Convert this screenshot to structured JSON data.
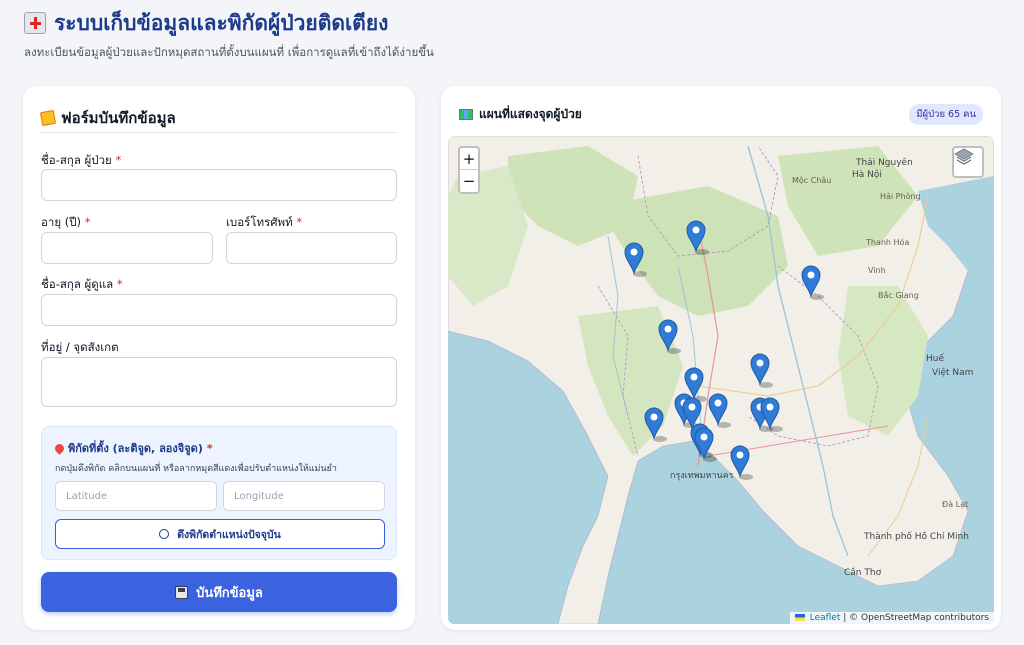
{
  "header": {
    "title": "ระบบเก็บข้อมูลและพิกัดผู้ป่วยติดเตียง",
    "subtitle": "ลงทะเบียนข้อมูลผู้ป่วยและปักหมุดสถานที่ตั้งบนแผนที่ เพื่อการดูแลที่เข้าถึงได้ง่ายขึ้น"
  },
  "form": {
    "title": "ฟอร์มบันทึกข้อมูล",
    "patient_name_label": "ชื่อ-สกุล ผู้ป่วย",
    "age_label": "อายุ (ปี)",
    "phone_label": "เบอร์โทรศัพท์",
    "caregiver_label": "ชื่อ-สกุล ผู้ดูแล",
    "address_label": "ที่อยู่ / จุดสังเกต",
    "required_mark": "*",
    "patient_name_value": "",
    "age_value": "",
    "phone_value": "",
    "caregiver_value": "",
    "address_value": "",
    "geo": {
      "title": "พิกัดที่ตั้ง (ละติจูด, ลองจิจูด)",
      "hint": "กดปุ่มดึงพิกัด คลิกบนแผนที่ หรือลากหมุดสีแดงเพื่อปรับตำแหน่งให้แม่นยำ",
      "lat_placeholder": "Latitude",
      "lng_placeholder": "Longitude",
      "gps_button": "ดึงพิกัดตำแหน่งปัจจุบัน"
    },
    "save_button": "บันทึกข้อมูล"
  },
  "map": {
    "title": "แผนที่แสดงจุดผู้ป่วย",
    "count_badge": "มีผู้ป่วย 65 คน",
    "zoom_in": "+",
    "zoom_out": "−",
    "attribution_leaflet": "Leaflet",
    "attribution_osm": "| © OpenStreetMap contributors",
    "labels": {
      "hanoi": "Hà Nội",
      "haiphong": "Hải Phòng",
      "vietnam": "Việt Nam",
      "hue": "Huế",
      "hcm": "Thành phố Hồ Chí Minh",
      "cantho": "Cần Thơ",
      "thainguyen": "Thái Nguyên",
      "dalat": "Đà Lạt",
      "vinh": "Vinh",
      "bangkok": "กรุงเทพมหานคร",
      "thanhhoa": "Thanh Hóa",
      "mocchau": "Mộc Châu",
      "baygiang": "Bắc Giang"
    },
    "marker_color": "#2f7bd6"
  },
  "colors": {
    "accent": "#3b63e0",
    "title": "#1e3a8a"
  }
}
